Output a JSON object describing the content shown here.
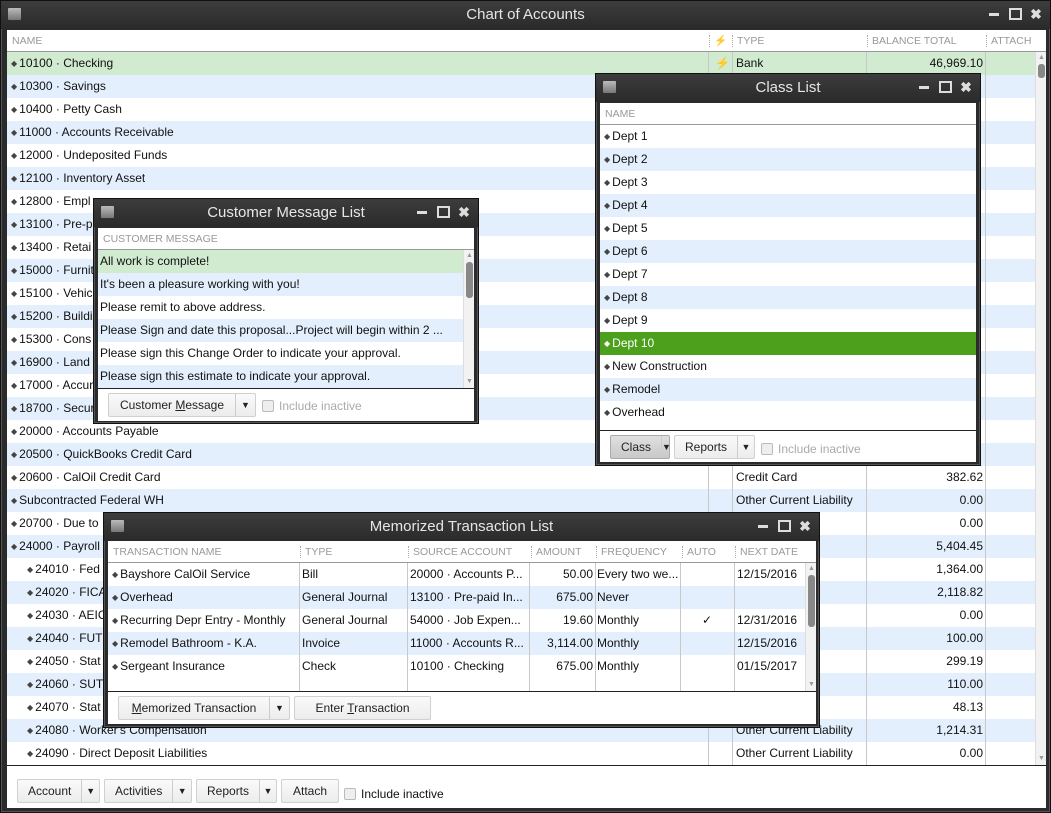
{
  "main": {
    "title": "Chart of Accounts",
    "columns": {
      "name": "NAME",
      "flag": "⚡",
      "type": "TYPE",
      "balance": "BALANCE TOTAL",
      "attach": "ATTACH"
    },
    "rows": [
      {
        "name": "10100 · Checking",
        "flag": "⚡",
        "type": "Bank",
        "balance": "46,969.10",
        "indent": 0,
        "selected": true
      },
      {
        "name": "10300 · Savings",
        "type": "",
        "balance": "",
        "indent": 0
      },
      {
        "name": "10400 · Petty Cash",
        "type": "",
        "balance": "",
        "indent": 0
      },
      {
        "name": "11000 · Accounts Receivable",
        "type": "",
        "balance": "",
        "indent": 0
      },
      {
        "name": "12000 · Undeposited Funds",
        "type": "",
        "balance": "",
        "indent": 0
      },
      {
        "name": "12100 · Inventory Asset",
        "type": "",
        "balance": "",
        "indent": 0
      },
      {
        "name": "12800 · Empl",
        "type": "",
        "balance": "",
        "indent": 0
      },
      {
        "name": "13100 · Pre-p",
        "type": "",
        "balance": "",
        "indent": 0
      },
      {
        "name": "13400 · Retai",
        "type": "",
        "balance": "",
        "indent": 0
      },
      {
        "name": "15000 · Furnit",
        "type": "",
        "balance": "",
        "indent": 0
      },
      {
        "name": "15100 · Vehic",
        "type": "",
        "balance": "",
        "indent": 0
      },
      {
        "name": "15200 · Buildi",
        "type": "",
        "balance": "",
        "indent": 0
      },
      {
        "name": "15300 · Cons",
        "type": "",
        "balance": "",
        "indent": 0
      },
      {
        "name": "16900 · Land",
        "type": "",
        "balance": "",
        "indent": 0
      },
      {
        "name": "17000 · Accur",
        "type": "",
        "balance": "",
        "indent": 0
      },
      {
        "name": "18700 · Secur",
        "type": "",
        "balance": "",
        "indent": 0
      },
      {
        "name": "20000 · Accounts Payable",
        "type": "",
        "balance": "",
        "indent": 0
      },
      {
        "name": "20500 · QuickBooks Credit Card",
        "type": "",
        "balance": "",
        "indent": 0
      },
      {
        "name": "20600 · CalOil Credit Card",
        "type": "Credit Card",
        "balance": "382.62",
        "indent": 0
      },
      {
        "name": "Subcontracted Federal WH",
        "type": "Other Current Liability",
        "balance": "0.00",
        "indent": 0
      },
      {
        "name": "20700 · Due to",
        "type": "ability",
        "balance": "0.00",
        "indent": 0
      },
      {
        "name": "24000 · Payroll",
        "type": "ability",
        "balance": "5,404.45",
        "indent": 0
      },
      {
        "name": "24010 · Fed",
        "type": "ability",
        "balance": "1,364.00",
        "indent": 1
      },
      {
        "name": "24020 · FICA",
        "type": "ability",
        "balance": "2,118.82",
        "indent": 1
      },
      {
        "name": "24030 · AEIC",
        "type": "ability",
        "balance": "0.00",
        "indent": 1
      },
      {
        "name": "24040 · FUT",
        "type": "ability",
        "balance": "100.00",
        "indent": 1
      },
      {
        "name": "24050 · Stat",
        "type": "ability",
        "balance": "299.19",
        "indent": 1
      },
      {
        "name": "24060 · SUT",
        "type": "ability",
        "balance": "110.00",
        "indent": 1
      },
      {
        "name": "24070 · Stat",
        "type": "ability",
        "balance": "48.13",
        "indent": 1
      },
      {
        "name": "24080 · Worker's Compensation",
        "type": "Other Current Liability",
        "balance": "1,214.31",
        "indent": 1
      },
      {
        "name": "24090 · Direct Deposit Liabilities",
        "type": "Other Current Liability",
        "balance": "0.00",
        "indent": 1
      }
    ],
    "footer": {
      "account": "Account",
      "activities": "Activities",
      "reports": "Reports",
      "attach": "Attach",
      "include_inactive": "Include inactive"
    }
  },
  "customer_message": {
    "title": "Customer Message List",
    "column": "CUSTOMER MESSAGE",
    "rows": [
      "All work is complete!",
      "It's been a pleasure working with you!",
      "Please remit to above address.",
      "Please Sign and date this proposal...Project will begin within 2 ...",
      "Please sign this Change Order to indicate your approval.",
      "Please sign this estimate to indicate your approval."
    ],
    "selected_index": 0,
    "button": "Customer Message",
    "include_inactive": "Include inactive"
  },
  "class_list": {
    "title": "Class List",
    "column": "NAME",
    "rows": [
      "Dept 1",
      "Dept 2",
      "Dept 3",
      "Dept 4",
      "Dept 5",
      "Dept 6",
      "Dept 7",
      "Dept 8",
      "Dept 9",
      "Dept 10",
      "New Construction",
      "Remodel",
      "Overhead"
    ],
    "selected_index": 9,
    "class_button": "Class",
    "reports_button": "Reports",
    "include_inactive": "Include inactive"
  },
  "memorized": {
    "title": "Memorized Transaction List",
    "columns": [
      "TRANSACTION NAME",
      "TYPE",
      "SOURCE ACCOUNT",
      "AMOUNT",
      "FREQUENCY",
      "AUTO",
      "NEXT DATE"
    ],
    "rows": [
      {
        "name": "Bayshore CalOil Service",
        "type": "Bill",
        "source": "20000 · Accounts P...",
        "amount": "50.00",
        "frequency": "Every two we...",
        "auto": "",
        "next": "12/15/2016"
      },
      {
        "name": "Overhead",
        "type": "General Journal",
        "source": "13100 · Pre-paid In...",
        "amount": "675.00",
        "frequency": "Never",
        "auto": "",
        "next": ""
      },
      {
        "name": "Recurring  Depr Entry - Monthly",
        "type": "General Journal",
        "source": "54000 · Job Expen...",
        "amount": "19.60",
        "frequency": "Monthly",
        "auto": "✓",
        "next": "12/31/2016"
      },
      {
        "name": "Remodel Bathroom - K.A.",
        "type": "Invoice",
        "source": "11000 · Accounts R...",
        "amount": "3,114.00",
        "frequency": "Monthly",
        "auto": "",
        "next": "12/15/2016"
      },
      {
        "name": "Sergeant Insurance",
        "type": "Check",
        "source": "10100 · Checking",
        "amount": "675.00",
        "frequency": "Monthly",
        "auto": "",
        "next": "01/15/2017"
      }
    ],
    "memorized_button": "Memorized Transaction",
    "enter_button": "Enter Transaction"
  }
}
